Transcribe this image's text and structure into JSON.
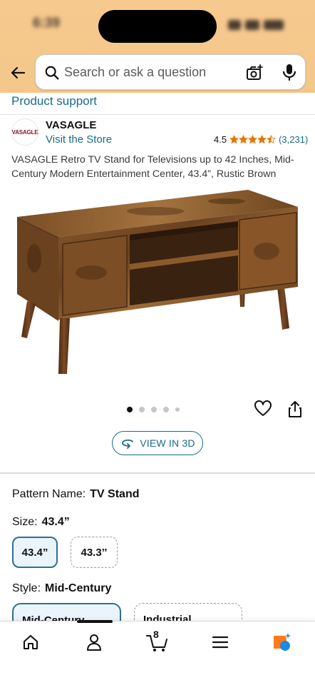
{
  "status_bar": {
    "time": "6:39"
  },
  "search": {
    "placeholder": "Search or ask a question"
  },
  "product_support": "Product support",
  "brand": {
    "logo_text": "VASAGLE",
    "name": "VASAGLE",
    "store_link": "Visit the Store"
  },
  "rating": {
    "value": "4.5",
    "stars": 4.5,
    "count": "(3,231)"
  },
  "product_title": "VASAGLE Retro TV Stand for Televisions up to 42 Inches, Mid-Century Modern Entertainment Center, 43.4”, Rustic Brown",
  "carousel": {
    "total": 5,
    "active": 0
  },
  "view_3d": {
    "label": "VIEW IN 3D"
  },
  "variations": {
    "pattern": {
      "label": "Pattern Name:",
      "value": "TV Stand"
    },
    "size": {
      "label": "Size:",
      "value": "43.4”",
      "options": [
        "43.4”",
        "43.3’’"
      ]
    },
    "style": {
      "label": "Style:",
      "value": "Mid-Century",
      "options": [
        "Mid-Century",
        "Industrial"
      ]
    }
  },
  "bottom_nav": {
    "cart_count": "8"
  },
  "colors": {
    "link": "#1a6a8a",
    "header_bg": "#f6c98e",
    "star": "#e77600",
    "selected_border": "#2f6f8f"
  },
  "icons": [
    "back-arrow-icon",
    "search-icon",
    "camera-icon",
    "mic-icon",
    "heart-icon",
    "share-icon",
    "view-3d-icon",
    "home-icon",
    "account-icon",
    "cart-icon",
    "menu-icon",
    "rufus-assistant-icon"
  ]
}
